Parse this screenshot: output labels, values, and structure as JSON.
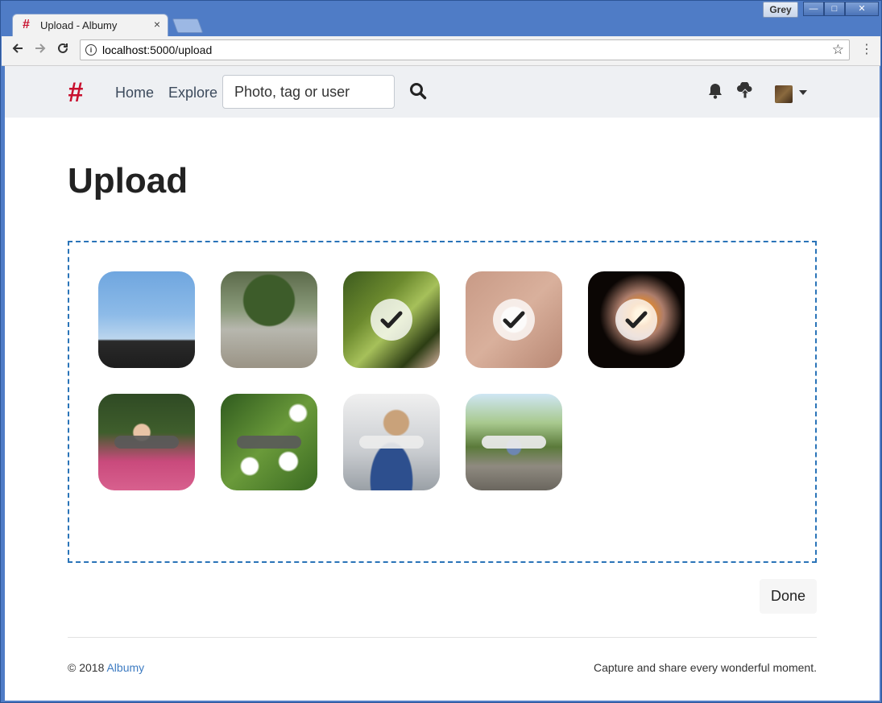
{
  "window": {
    "profile_name": "Grey",
    "min_glyph": "—",
    "max_glyph": "□",
    "close_glyph": "✕"
  },
  "tab": {
    "favicon": "#",
    "title": "Upload - Albumy",
    "close": "×"
  },
  "toolbar": {
    "url_host": "localhost",
    "url_rest": ":5000/upload"
  },
  "navbar": {
    "brand": "#",
    "links": [
      "Home",
      "Explore"
    ],
    "search_placeholder": "Photo, tag or user"
  },
  "page": {
    "title": "Upload",
    "done_label": "Done"
  },
  "uploads": [
    {
      "status": "uploaded",
      "checked": false
    },
    {
      "status": "uploaded",
      "checked": false
    },
    {
      "status": "uploaded",
      "checked": true
    },
    {
      "status": "uploaded",
      "checked": true
    },
    {
      "status": "uploaded",
      "checked": true
    },
    {
      "status": "uploading",
      "progress": 0
    },
    {
      "status": "uploading",
      "progress": 0
    },
    {
      "status": "uploading",
      "progress": 0
    },
    {
      "status": "uploading",
      "progress": 0
    }
  ],
  "footer": {
    "copyright": "© 2018 ",
    "brand_link": "Albumy",
    "tagline": "Capture and share every wonderful moment."
  },
  "colors": {
    "brand": "#c8102e",
    "link": "#3e7cc2",
    "dropzone_border": "#2a74b8"
  }
}
